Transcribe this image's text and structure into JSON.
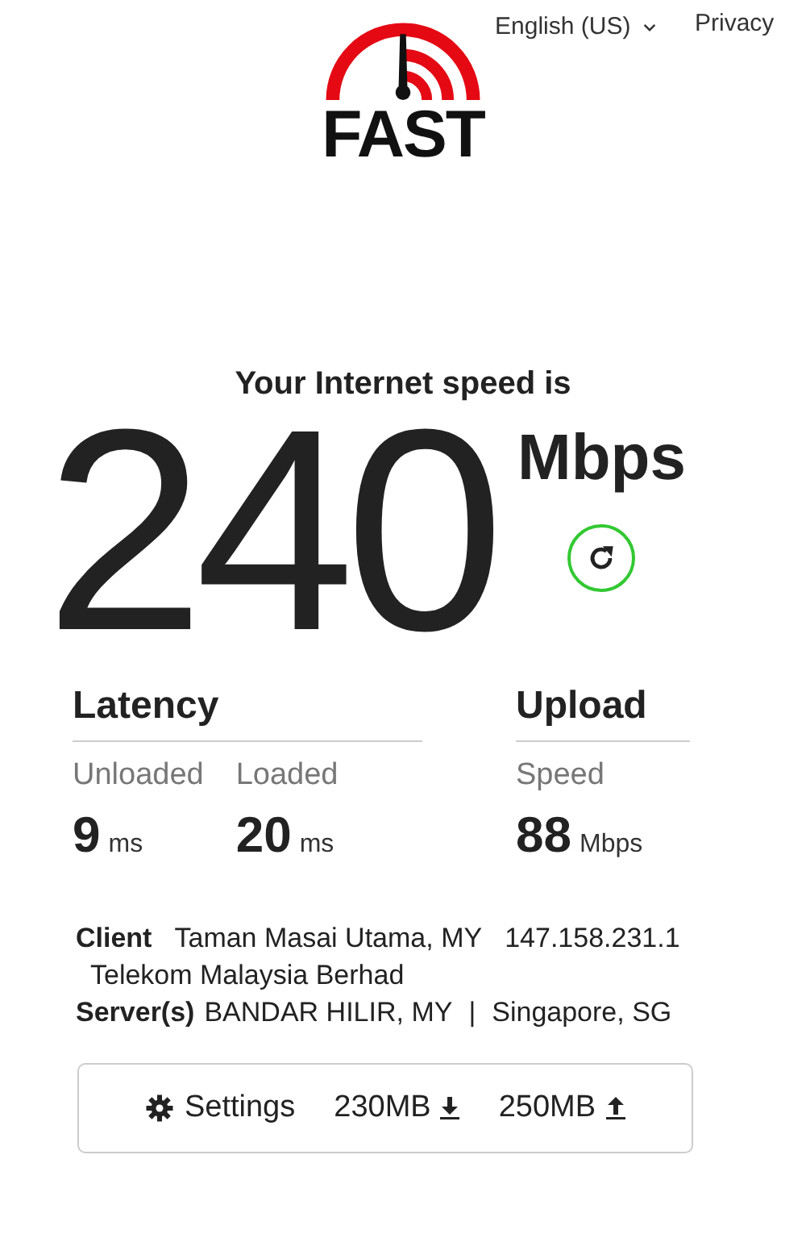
{
  "header": {
    "logo_text": "FAST",
    "language": "English (US)",
    "privacy": "Privacy"
  },
  "result": {
    "heading": "Your Internet speed is",
    "speed": "240",
    "unit": "Mbps"
  },
  "metrics": [
    {
      "title": "Latency",
      "items": [
        {
          "label": "Unloaded",
          "value": "9",
          "unit": "ms"
        },
        {
          "label": "Loaded",
          "value": "20",
          "unit": "ms"
        }
      ]
    },
    {
      "title": "Upload",
      "items": [
        {
          "label": "Speed",
          "value": "88",
          "unit": "Mbps"
        }
      ]
    }
  ],
  "client": {
    "label": "Client",
    "location": "Taman Masai Utama, MY",
    "ip": "147.158.231.1",
    "isp": "Telekom Malaysia Berhad"
  },
  "servers": {
    "label": "Server(s)",
    "locations": [
      "BANDAR HILIR, MY",
      "Singapore, SG"
    ],
    "separator": "|"
  },
  "settings_bar": {
    "label": "Settings",
    "download": "230MB",
    "upload": "250MB"
  }
}
